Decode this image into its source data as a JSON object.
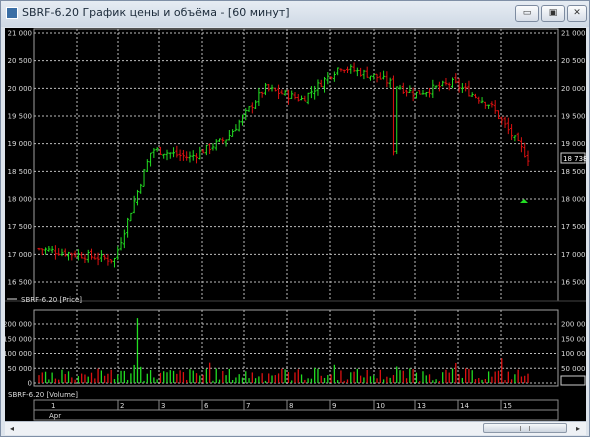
{
  "window": {
    "title": "SBRF-6.20 График цены и объёма - [60 минут]",
    "buttons": {
      "minimize": "▭",
      "restore": "▣",
      "close": "✕"
    }
  },
  "scrollbar": {
    "left_arrow": "◂",
    "right_arrow": "▸"
  },
  "price_panel": {
    "y_ticks": [
      "21 000",
      "20 500",
      "20 000",
      "19 500",
      "19 000",
      "18 500",
      "18 000",
      "17 500",
      "17 000",
      "16 500"
    ],
    "last_price": "18 738",
    "legend": "SBRF-6.20 [Price]"
  },
  "volume_panel": {
    "y_ticks": [
      "200 000",
      "150 000",
      "100 000",
      "50 000",
      "0"
    ],
    "legend": "SBRF-6.20 [Volume]"
  },
  "date_axis": {
    "days": [
      "1",
      "2",
      "3",
      "6",
      "7",
      "8",
      "9",
      "10",
      "13",
      "14",
      "15"
    ],
    "month": "Apr"
  },
  "chart_data": [
    {
      "type": "bar",
      "legend": "SBRF-6.20 [Price]",
      "ylim": [
        16500,
        21000
      ],
      "categories": [
        "1",
        "2",
        "3",
        "6",
        "7",
        "8",
        "9",
        "10",
        "13",
        "14",
        "15"
      ],
      "month": "Apr",
      "approx_price_path": [
        17100,
        17000,
        16900,
        18900,
        18750,
        19100,
        20000,
        19800,
        20400,
        20200,
        19900,
        20100,
        19700,
        18738
      ],
      "last_price": 18738,
      "up_color": "#22dd22",
      "down_color": "#dd1111",
      "signal_marker_price": 17950
    },
    {
      "type": "bar",
      "legend": "SBRF-6.20 [Volume]",
      "ylim": [
        0,
        220000
      ],
      "peak_volume": 220000,
      "typical_volume": 40000
    }
  ]
}
